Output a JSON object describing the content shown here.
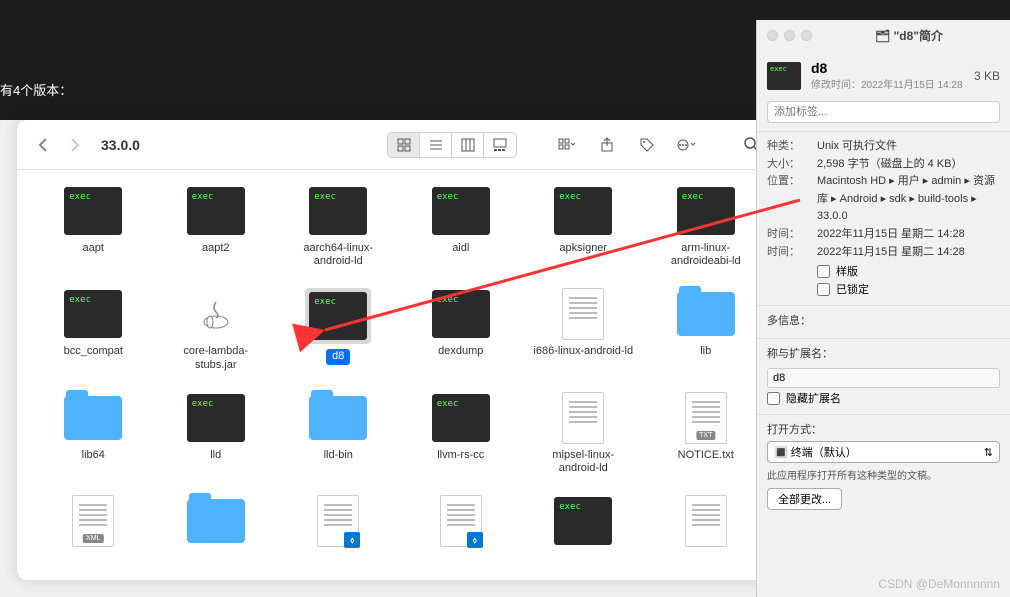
{
  "dark_area": {
    "text": "有4个版本："
  },
  "finder": {
    "title": "33.0.0",
    "files": [
      {
        "name": "aapt",
        "type": "exec"
      },
      {
        "name": "aapt2",
        "type": "exec"
      },
      {
        "name": "aarch64-linux-android-ld",
        "type": "exec"
      },
      {
        "name": "aidl",
        "type": "exec"
      },
      {
        "name": "apksigner",
        "type": "exec"
      },
      {
        "name": "arm-linux-androideabi-ld",
        "type": "exec"
      },
      {
        "name": "bcc_compat",
        "type": "exec"
      },
      {
        "name": "core-lambda-stubs.jar",
        "type": "jar"
      },
      {
        "name": "d8",
        "type": "exec",
        "selected": true
      },
      {
        "name": "dexdump",
        "type": "exec"
      },
      {
        "name": "i686-linux-android-ld",
        "type": "doc"
      },
      {
        "name": "lib",
        "type": "folder"
      },
      {
        "name": "lib64",
        "type": "folder"
      },
      {
        "name": "lld",
        "type": "exec"
      },
      {
        "name": "lld-bin",
        "type": "folder"
      },
      {
        "name": "llvm-rs-cc",
        "type": "exec"
      },
      {
        "name": "mipsel-linux-android-ld",
        "type": "doc"
      },
      {
        "name": "NOTICE.txt",
        "type": "txt"
      },
      {
        "name": "",
        "type": "xml"
      },
      {
        "name": "",
        "type": "folder"
      },
      {
        "name": "",
        "type": "vscode"
      },
      {
        "name": "",
        "type": "vscode"
      },
      {
        "name": "",
        "type": "exec"
      },
      {
        "name": "",
        "type": "doc"
      }
    ]
  },
  "info": {
    "title": "\"d8\"简介",
    "name": "d8",
    "size": "3 KB",
    "modified_label": "修改时间：",
    "modified": "2022年11月15日 14:28",
    "tags_placeholder": "添加标签...",
    "kind_label": "种类：",
    "kind": "Unix 可执行文件",
    "bytes_label": "大小：",
    "bytes": "2,598 字节（磁盘上的 4 KB）",
    "where_label": "位置：",
    "where": "Macintosh HD ▸ 用户 ▸ admin ▸ 资源库 ▸ Android ▸ sdk ▸ build-tools ▸ 33.0.0",
    "created_label": "时间：",
    "created": "2022年11月15日 星期二 14:28",
    "modified2_label": "时间：",
    "modified2": "2022年11月15日 星期二 14:28",
    "stationery": "样版",
    "locked": "已锁定",
    "more_info": "多信息：",
    "name_ext": "称与扩展名：",
    "name_value": "d8",
    "hide_ext": "隐藏扩展名",
    "open_with": "打开方式：",
    "app": "终端（默认）",
    "app_note": "此应用程序打开所有这种类型的文稿。",
    "change_all": "全部更改..."
  },
  "watermark": "CSDN @DeMonnnnnn"
}
